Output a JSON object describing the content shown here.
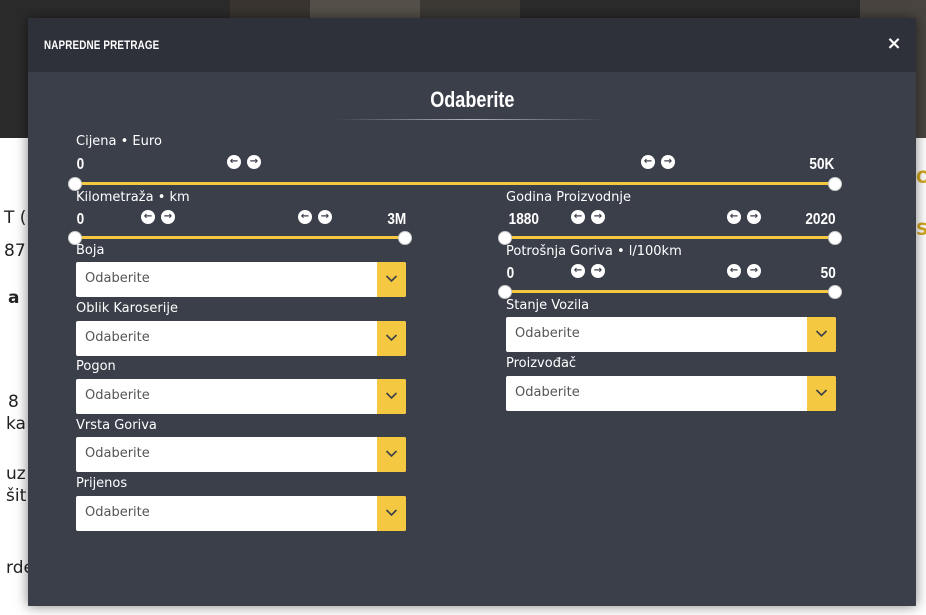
{
  "background": {
    "fragments": [
      "T (",
      "87",
      "a",
      "8",
      "ka",
      "uz",
      "šit",
      "rde"
    ],
    "side_fragments": [
      "O",
      "S"
    ]
  },
  "modal": {
    "title": "NAPREDNE PRETRAGE",
    "close_icon": "×",
    "section_title": "Odaberite"
  },
  "ranges": {
    "price": {
      "label": "Cijena • Euro",
      "min": "0",
      "max": "50K"
    },
    "mileage": {
      "label": "Kilometraža • km",
      "min": "0",
      "max": "3M"
    },
    "year": {
      "label": "Godina Proizvodnje",
      "min": "1880",
      "max": "2020"
    },
    "fuel_consumption": {
      "label": "Potrošnja Goriva • l/100km",
      "min": "0",
      "max": "50"
    }
  },
  "arrows": {
    "left": "←",
    "right": "→"
  },
  "selects": {
    "color": {
      "label": "Boja",
      "value": "Odaberite"
    },
    "body_type": {
      "label": "Oblik Karoserije",
      "value": "Odaberite"
    },
    "drive": {
      "label": "Pogon",
      "value": "Odaberite"
    },
    "fuel_type": {
      "label": "Vrsta Goriva",
      "value": "Odaberite"
    },
    "transmission": {
      "label": "Prijenos",
      "value": "Odaberite"
    },
    "condition": {
      "label": "Stanje Vozila",
      "value": "Odaberite"
    },
    "manufacturer": {
      "label": "Proizvođač",
      "value": "Odaberite"
    }
  },
  "colors": {
    "accent": "#f5c842",
    "modal_bg": "#3b3f4a",
    "header_bg": "#2e313a"
  }
}
